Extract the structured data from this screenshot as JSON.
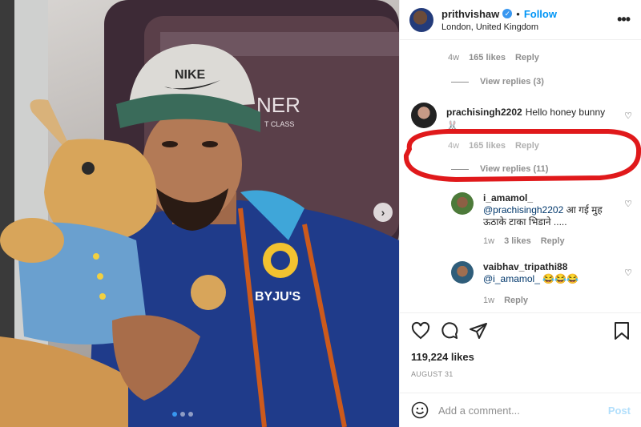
{
  "header": {
    "username": "prithvishaw",
    "separator": "•",
    "follow_label": "Follow",
    "location": "London, United Kingdom",
    "more_label": "•••"
  },
  "comments": {
    "prev_meta": {
      "time": "4w",
      "likes": "165 likes",
      "reply": "Reply"
    },
    "view_replies_1": "View replies (3)",
    "highlighted": {
      "user": "prachisingh2202",
      "text": "Hello honey bunny",
      "emoji": "🐰",
      "meta_time": "4w",
      "meta_likes": "165 likes",
      "meta_reply": "Reply"
    },
    "view_replies_2": "View replies (11)",
    "replies": [
      {
        "user": "i_amamol_",
        "mention": "@prachisingh2202",
        "text": " आ गई मुह ऊठाके टाका भिडाने .....",
        "time": "1w",
        "likes": "3 likes",
        "reply": "Reply"
      },
      {
        "user": "vaibhav_tripathi88",
        "mention": "@i_amamol_",
        "text": " 😂😂😂",
        "time": "1w",
        "reply": "Reply"
      }
    ]
  },
  "likes": "119,224 likes",
  "date": "AUGUST 31",
  "add_comment": {
    "placeholder": "Add a comment...",
    "post_label": "Post"
  },
  "photo": {
    "cap_brand": "NIKE",
    "seat_text": "NER",
    "seat_subtext": "T CLASS",
    "jacket_text": "BYJU'S",
    "next_arrow": "›"
  },
  "colors": {
    "accent": "#0095f6",
    "highlight_ring": "#e0191b",
    "verified": "#3897f0"
  }
}
